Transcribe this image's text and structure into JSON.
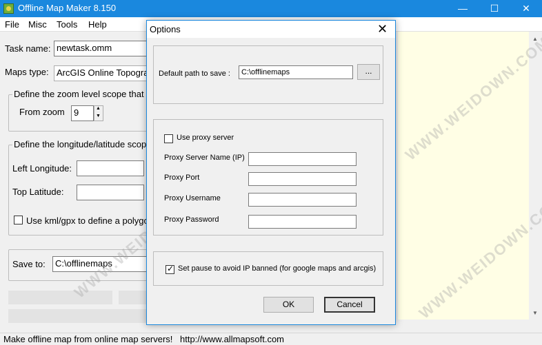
{
  "window": {
    "title": "Offline Map Maker 8.150",
    "minimize": "—",
    "maximize": "☐",
    "close": "✕"
  },
  "menu": [
    "File",
    "Misc",
    "Tools",
    "Help"
  ],
  "main": {
    "task_name_label": "Task name:",
    "task_name_value": "newtask.omm",
    "maps_type_label": "Maps type:",
    "maps_type_value": "ArcGIS Online Topogra",
    "zoom_group_title": "Define the zoom level scope that y",
    "from_zoom_label": "From zoom",
    "from_zoom_value": "9",
    "lonlat_group_title": "Define the longitude/latitude scope",
    "left_longitude_label": "Left Longitude:",
    "top_latitude_label": "Top Latitude:",
    "kml_checkbox_label": "Use kml/gpx to define a polygo",
    "save_to_label": "Save to:",
    "save_to_value": "C:\\offlinemaps"
  },
  "statusbar": {
    "message": "Make offline map from online map servers!",
    "url": "http://www.allmapsoft.com"
  },
  "dialog": {
    "title": "Options",
    "close": "✕",
    "default_path_label": "Default path to save :",
    "default_path_value": "C:\\offlinemaps",
    "browse_label": "...",
    "use_proxy_label": "Use proxy server",
    "proxy_server_label": "Proxy Server Name (IP)",
    "proxy_port_label": "Proxy Port",
    "proxy_username_label": "Proxy Username",
    "proxy_password_label": "Proxy Password",
    "set_pause_label": "Set pause to avoid IP banned (for google maps and arcgis)",
    "ok_label": "OK",
    "cancel_label": "Cancel"
  },
  "watermark": "WWW.WEIDOWN.COM",
  "colors": {
    "titlebar": "#1a88de",
    "map_panel": "#fffee5",
    "dialog_border": "#1a88de"
  }
}
